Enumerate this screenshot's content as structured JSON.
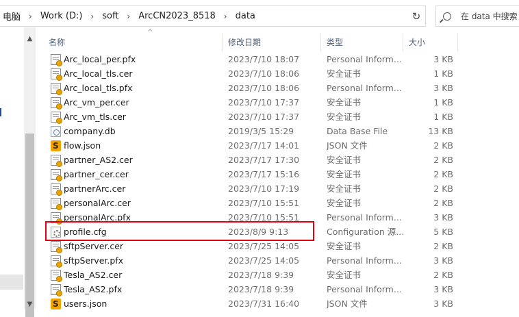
{
  "address_bar": {
    "crumbs": [
      "电脑",
      "Work (D:)",
      "soft",
      "ArcCN2023_8518",
      "data"
    ]
  },
  "search": {
    "placeholder": "在 data 中搜索"
  },
  "columns": {
    "name": "名称",
    "date": "修改日期",
    "type": "类型",
    "size": "大小"
  },
  "files": [
    {
      "name": "Arc_local_per.pfx",
      "date": "2023/7/10 18:07",
      "type": "Personal Inform...",
      "size": "3 KB",
      "icon": "certificate-icon"
    },
    {
      "name": "Arc_local_tls.cer",
      "date": "2023/7/10 18:06",
      "type": "安全证书",
      "size": "1 KB",
      "icon": "certificate-icon"
    },
    {
      "name": "Arc_local_tls.pfx",
      "date": "2023/7/10 18:06",
      "type": "Personal Inform...",
      "size": "3 KB",
      "icon": "certificate-icon"
    },
    {
      "name": "Arc_vm_per.cer",
      "date": "2023/7/10 17:37",
      "type": "安全证书",
      "size": "1 KB",
      "icon": "certificate-icon"
    },
    {
      "name": "Arc_vm_tls.cer",
      "date": "2023/7/10 17:37",
      "type": "安全证书",
      "size": "1 KB",
      "icon": "certificate-icon"
    },
    {
      "name": "company.db",
      "date": "2019/3/5 15:29",
      "type": "Data Base File",
      "size": "13 KB",
      "icon": "database-file-icon"
    },
    {
      "name": "flow.json",
      "date": "2023/7/17 14:01",
      "type": "JSON 文件",
      "size": "2 KB",
      "icon": "json-file-icon"
    },
    {
      "name": "partner_AS2.cer",
      "date": "2023/7/17 17:30",
      "type": "安全证书",
      "size": "2 KB",
      "icon": "certificate-icon"
    },
    {
      "name": "partner_cer.cer",
      "date": "2023/7/17 15:16",
      "type": "安全证书",
      "size": "2 KB",
      "icon": "certificate-icon"
    },
    {
      "name": "partnerArc.cer",
      "date": "2023/7/10 17:19",
      "type": "安全证书",
      "size": "2 KB",
      "icon": "certificate-icon"
    },
    {
      "name": "personalArc.cer",
      "date": "2023/7/10 15:51",
      "type": "安全证书",
      "size": "2 KB",
      "icon": "certificate-icon"
    },
    {
      "name": "personalArc.pfx",
      "date": "2023/7/10 15:51",
      "type": "Personal Inform...",
      "size": "3 KB",
      "icon": "certificate-icon"
    },
    {
      "name": "profile.cfg",
      "date": "2023/8/9 9:13",
      "type": "Configuration 源...",
      "size": "5 KB",
      "icon": "config-file-icon"
    },
    {
      "name": "sftpServer.cer",
      "date": "2023/7/25 14:05",
      "type": "安全证书",
      "size": "2 KB",
      "icon": "certificate-icon"
    },
    {
      "name": "sftpServer.pfx",
      "date": "2023/7/25 14:05",
      "type": "Personal Inform...",
      "size": "3 KB",
      "icon": "certificate-icon"
    },
    {
      "name": "Tesla_AS2.cer",
      "date": "2023/7/18 9:39",
      "type": "安全证书",
      "size": "2 KB",
      "icon": "certificate-icon"
    },
    {
      "name": "Tesla_AS2.pfx",
      "date": "2023/7/18 9:39",
      "type": "Personal Inform...",
      "size": "3 KB",
      "icon": "certificate-icon"
    },
    {
      "name": "users.json",
      "date": "2023/7/31 16:40",
      "type": "JSON 文件",
      "size": "3 KB",
      "icon": "json-file-icon"
    }
  ],
  "highlighted_file": "profile.cfg",
  "colors": {
    "highlight": "#e3000f",
    "header_text": "#4c607a"
  }
}
